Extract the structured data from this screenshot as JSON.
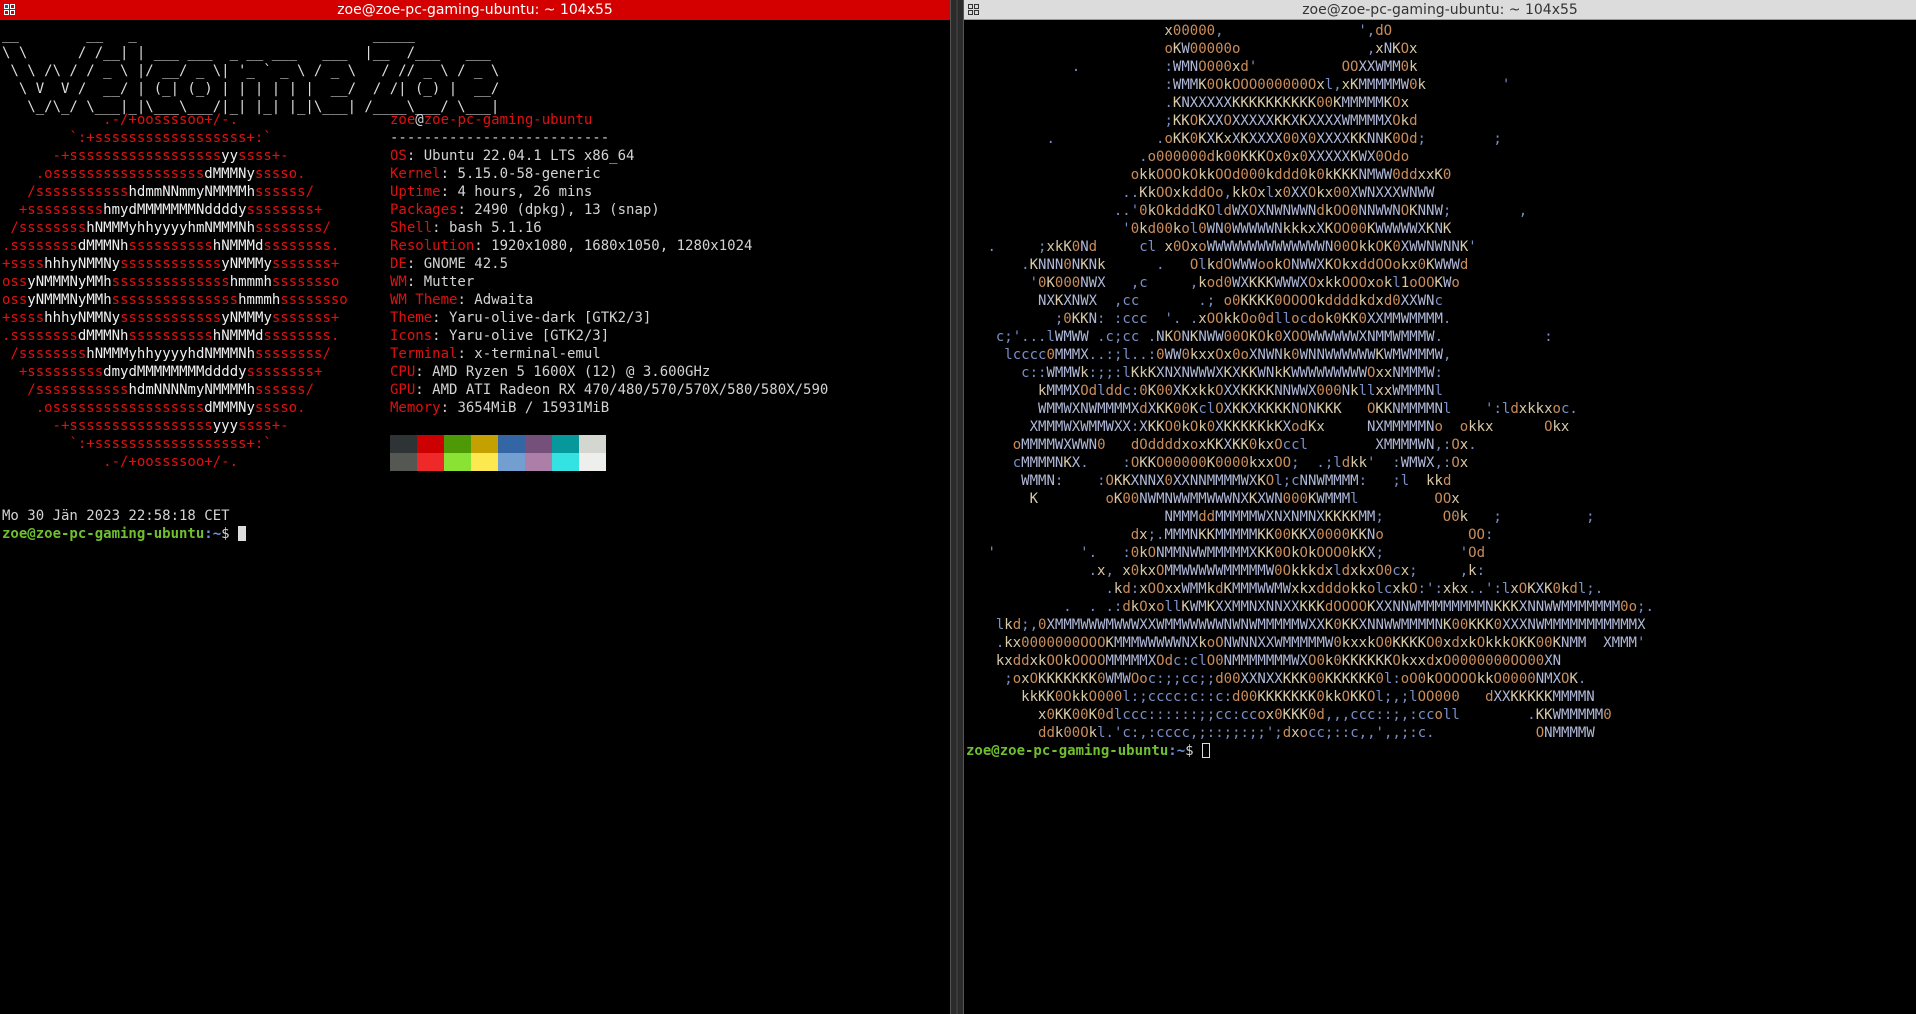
{
  "left_terminal": {
    "title": "zoe@zoe-pc-gaming-ubuntu: ~ 104x55",
    "ascii_title": "__        __   _                            _____\n\\ \\      / /__| | ___ ___  _ __ ___   ___  |__  /___   ___\n \\ \\ /\\ / / _ \\ |/ __/ _ \\| '_ ` _ \\ / _ \\   / // _ \\ / _ \\\n  \\ V  V /  __/ | (_| (_) | | | | | |  __/  / /| (_) |  __/\n   \\_/\\_/ \\___|_|\\___\\___/|_| |_| |_|\\___| /____\\___/ \\___|",
    "logo_lines": [
      "            .-/+oossssoo+/-.",
      "        `:+ssssssssssssssssss+:`",
      "      -+ssssssssssssssssssyyssss+-",
      "    .ossssssssssssssssssdMMMNysssso.",
      "   /ssssssssssshdmmNNmmyNMMMMhssssss/",
      "  +ssssssssshmydMMMMMMMNddddyssssssss+",
      " /sssssssshNMMMyhhyyyyhmNMMMNhssssssss/",
      ".ssssssssdMMMNhsssssssssshNMMMdssssssss.",
      "+sssshhhyNMMNyssssssssssssyNMMMysssssss+",
      "ossyNMMMNyMMhsssssssssssssshmmmhssssssso",
      "ossyNMMMNyMMhssssssssssssssshmmmhssssssso",
      "+sssshhhyNMMNyssssssssssssyNMMMysssssss+",
      ".ssssssssdMMMNhsssssssssshNMMMdssssssss.",
      " /sssssssshNMMMyhhyyyyhdNMMMNhssssssss/",
      "  +sssssssssdmydMMMMMMMMddddyssssssss+",
      "   /ssssssssssshdmNNNNmyNMMMMhssssss/",
      "    .ossssssssssssssssssdMMMNysssso.",
      "      -+sssssssssssssssssyyyssss+-",
      "        `:+ssssssssssssssssss+:`",
      "            .-/+oossssoo+/-."
    ],
    "user": "zoe",
    "at": "@",
    "host": "zoe-pc-gaming-ubuntu",
    "separator": "--------------------------",
    "info": [
      {
        "key": "OS",
        "value": "Ubuntu 22.04.1 LTS x86_64"
      },
      {
        "key": "Kernel",
        "value": "5.15.0-58-generic"
      },
      {
        "key": "Uptime",
        "value": "4 hours, 26 mins"
      },
      {
        "key": "Packages",
        "value": "2490 (dpkg), 13 (snap)"
      },
      {
        "key": "Shell",
        "value": "bash 5.1.16"
      },
      {
        "key": "Resolution",
        "value": "1920x1080, 1680x1050, 1280x1024"
      },
      {
        "key": "DE",
        "value": "GNOME 42.5"
      },
      {
        "key": "WM",
        "value": "Mutter"
      },
      {
        "key": "WM Theme",
        "value": "Adwaita"
      },
      {
        "key": "Theme",
        "value": "Yaru-olive-dark [GTK2/3]"
      },
      {
        "key": "Icons",
        "value": "Yaru-olive [GTK2/3]"
      },
      {
        "key": "Terminal",
        "value": "x-terminal-emul"
      },
      {
        "key": "CPU",
        "value": "AMD Ryzen 5 1600X (12) @ 3.600GHz"
      },
      {
        "key": "GPU",
        "value": "AMD ATI Radeon RX 470/480/570/570X/580/580X/590"
      },
      {
        "key": "Memory",
        "value": "3654MiB / 15931MiB"
      }
    ],
    "palette_top": [
      "#2e3436",
      "#cc0000",
      "#4e9a06",
      "#c4a000",
      "#3465a4",
      "#75507b",
      "#06989a",
      "#d3d7cf"
    ],
    "palette_bottom": [
      "#555753",
      "#ef2929",
      "#8ae234",
      "#fce94f",
      "#729fcf",
      "#ad7fa8",
      "#34e2e2",
      "#eeeeec"
    ],
    "date_line": "Mo 30 Jän 2023 22:58:18 CET",
    "prompt_user_host": "zoe@zoe-pc-gaming-ubuntu",
    "prompt_path": ":~",
    "prompt_symbol": "$ "
  },
  "right_terminal": {
    "title": "zoe@zoe-pc-gaming-ubuntu: ~ 104x55",
    "art_lines": [
      "                      x00000,                ',dO",
      "                      oKW00000o               ,xNKOx",
      "           .          :WMNO000xd'          OOXXWMM0k",
      "                      :WMMK0OkOOO000000Oxl,xKMMMMMW0k         '",
      "                      .KNXXXXXKKKKKKKKKK00KMMMMMKOx",
      "                      ;KKOKXXOXXXXXKKXKXXXXWMMMMXOkd",
      "        .            .oKK0KXKxXKXXXX00X0XXXXKKNNK0Od;        ;",
      "                   .o000000dk00KKKOx0x0XXXXXKWX0Odo",
      "                  okkOOOkOkkOOd000kddd0k0kKKKNMWW0ddxxK0",
      "                 ..KkOOxkddOo,kkOxlx0XXOkx00XWNXXXWNWW",
      "                ..'0kOkdddKOldWXOXNWNWWNdkOO0NNWWNOKNNW;        ,",
      "                 '0kd00kol0WN0WWWWWNkkkxXKOO00KWWWWWXKNK",
      " .     ;xkK0Nd     cl x0OxoWWWWWWWWWWWWWWN00OkkOK0XWWNWNNK'",
      "     .KNNN0NKNk      .   OlkdOWWWookONWWXKOkxddOOokx0KWWWd",
      "      '0K000NWX   ,c     ,kod0WXKKKWWWXOxkkOOOxokl1oOOKWo",
      "       NXKXNWX  ,cc       .; o0KKKK0OOOOkddddkdxd0XXWNc",
      "         ;0KKN: :ccc  '. .xOOkkOo0dllocdok0KK0XXMMWMMMM.",
      "  c;'...lWMWW .c;cc .NKONKNWW00OKOk0XOOWWWWWWXNMMWMMMW.            :",
      "   lcccc0MMMX..:;l..:0WW0kxxOx0oXNWNk0WNNWWWWWWKWMWMMMW,",
      "     c::WMMWk:;;:lKkKXNXNWWWXKXKKWNkKWWWWWWWWWOxxNMMMW:",
      "       kMMMXOdlddc:0K00XKxkkOXXKKKKNNWWX000NkllxxWMMMNl",
      "       WMMWXNWMMMMXdXKK00KclOXKKXKKKKNONKKK   OKKNMMMMNl    ':ldxkkxoc.",
      "      XMMMWXWMMWXX:XKKO0kOk0XKKKKKkKXodKx     NXMMMMMNo  okkx      Okx",
      "    oMMMMWXWWN0   dOddddxoxKKXKK0kxOccl        XMMMMWN,:Ox.",
      "    cMMMMNKX.    :OKKO00000K0000kxxOO;  .;ldkk'  :WMWX,:Ox",
      "     WMMN:    :OKKXNNX0XXNNMMMMWXKOl;cNNWMMMM:   ;l  kkd",
      "      K        oK00NWMNWWMMWWWNXKXWN000KWMMMl         OOx",
      "                      NMMMddMMMMMWXNXNMNXKKKKMM;       O0k   ;          ;",
      "                  dx;.MMMNKKMMMMMKK00KKX0000KKNo          OO:",
      " '          '.   :0kONMMNWWMMMMMXKK0OkOkOOO0kKX;         'Od",
      "             .x, x0kxOMMWWWWWMMMMMW0OkkkdxldxkxO0cx;     ,k:",
      "               .kd:xOOxxWMMkdKMMMWWMWxkxdddokkolcxkO:':xkx..':lxOKXK0kdl;.",
      "          .  . .:dkOxollKWMKXXMMNXNNXXKKKdOOOOKXXNNWMMMMMMMMNKKKXNNWWMMMMMMM0o;.",
      "  lkd;,0XMMMWWWMWWWXXWMMWWWWWNWNWMMMMMWXXK0KKXNNWWMMMMNK00KKK0XXXNWMMMMMMMMMMMX",
      "  .kx0000000OOOKMMMWWWWWNXkoONWNNXXWMMMMMW0kxxkO0KKKKO0xdxkOkkkOKK00KNMM  XMMM'",
      "  kxddxkOOkOOOOMMMMMXOdc:clO0NMMMMMMMWXO0k0KKKKKKOkxxdxO0000000OO00XN",
      "   ;oxOKKKKKKK0WMWOoc:;;cc;;d00XXNXXKKK00KKKKKK0l:oO0kOOOOOkkO0000NMXOK.",
      "     kkKK0OkkO000l:;cccc:c::c:d00KKKKKKK0kkOKKOl;,;lOO000   dXXKKKKKMMMMN",
      "       x0KK00K0dlccc::::::;;cc:ccox0KKK0d,,,ccc::;,:ccoll        .KKWMMMMM0",
      "       ddk00Okl.'c:,:cccc,;::;;:;;';dxocc;::c,,',,;:c.            ONMMMMW"
    ],
    "prompt_user_host": "zoe@zoe-pc-gaming-ubuntu",
    "prompt_path": ":~",
    "prompt_symbol": "$ "
  }
}
